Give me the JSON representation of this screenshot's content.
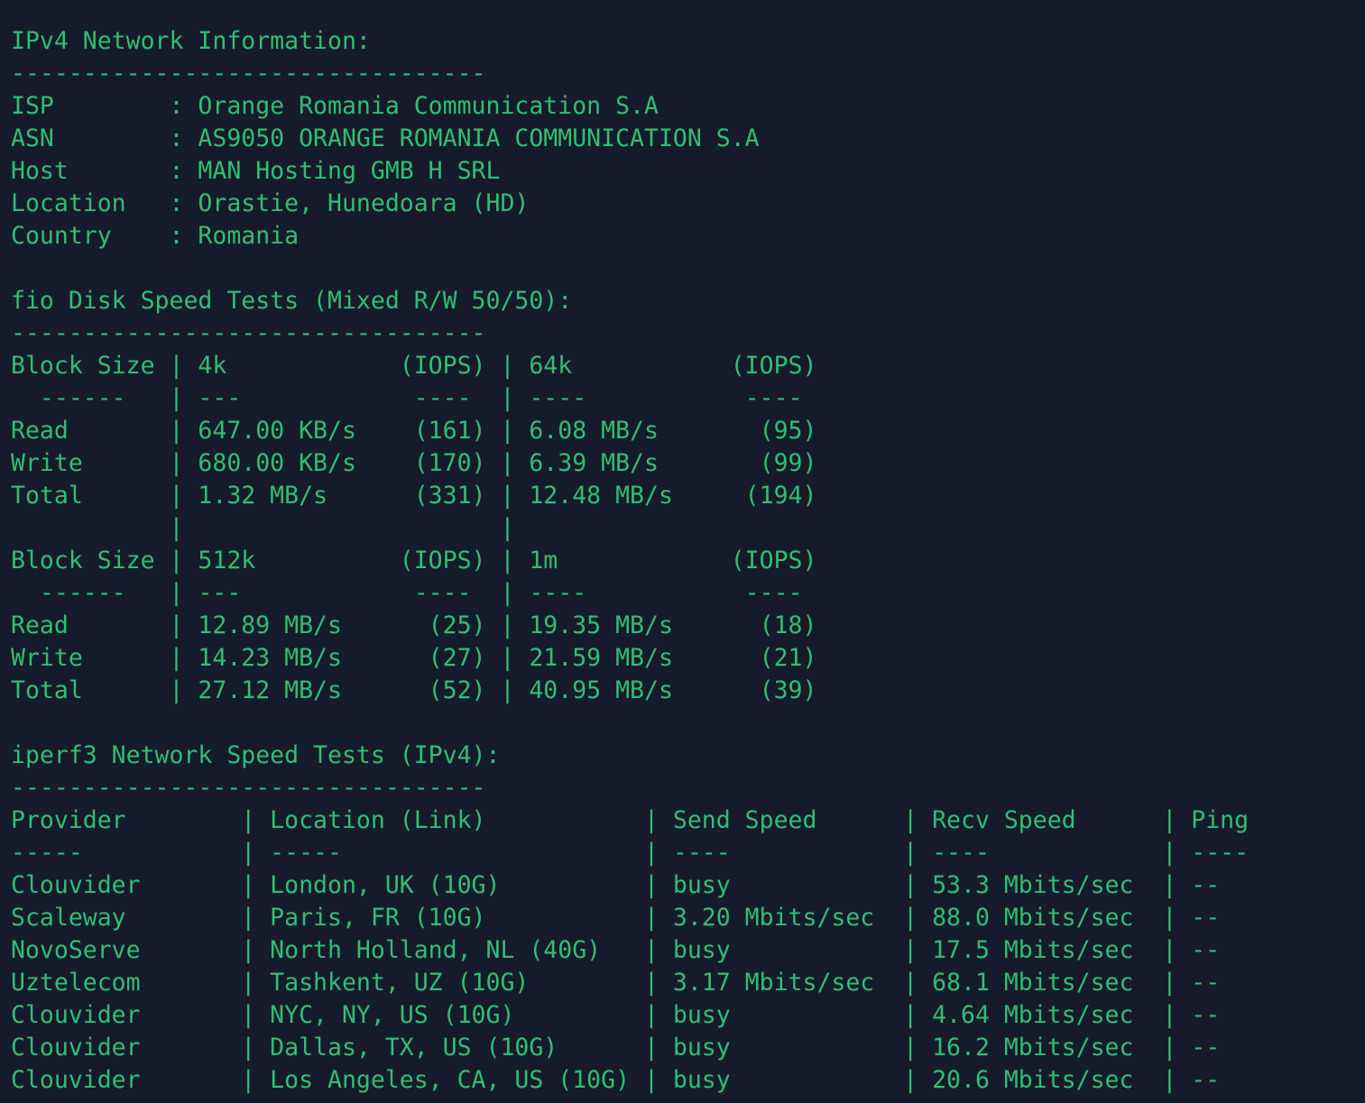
{
  "terminal": {
    "text_color": "#2fbf71",
    "background_color": "#161b2b",
    "lines": [
      "IPv4 Network Information:",
      "---------------------------------",
      "ISP        : Orange Romania Communication S.A",
      "ASN        : AS9050 ORANGE ROMANIA COMMUNICATION S.A",
      "Host       : MAN Hosting GMB H SRL",
      "Location   : Orastie, Hunedoara (HD)",
      "Country    : Romania",
      "",
      "fio Disk Speed Tests (Mixed R/W 50/50):",
      "---------------------------------",
      "Block Size | 4k            (IOPS) | 64k           (IOPS)",
      "  ------   | ---            ----  | ----           ----",
      "Read       | 647.00 KB/s    (161) | 6.08 MB/s       (95)",
      "Write      | 680.00 KB/s    (170) | 6.39 MB/s       (99)",
      "Total      | 1.32 MB/s      (331) | 12.48 MB/s     (194)",
      "           |                      |",
      "Block Size | 512k          (IOPS) | 1m            (IOPS)",
      "  ------   | ---            ----  | ----           ----",
      "Read       | 12.89 MB/s      (25) | 19.35 MB/s      (18)",
      "Write      | 14.23 MB/s      (27) | 21.59 MB/s      (21)",
      "Total      | 27.12 MB/s      (52) | 40.95 MB/s      (39)",
      "",
      "iperf3 Network Speed Tests (IPv4):",
      "---------------------------------",
      "Provider        | Location (Link)           | Send Speed      | Recv Speed      | Ping",
      "-----           | -----                     | ----            | ----            | ----",
      "Clouvider       | London, UK (10G)          | busy            | 53.3 Mbits/sec  | --",
      "Scaleway        | Paris, FR (10G)           | 3.20 Mbits/sec  | 88.0 Mbits/sec  | --",
      "NovoServe       | North Holland, NL (40G)   | busy            | 17.5 Mbits/sec  | --",
      "Uztelecom       | Tashkent, UZ (10G)        | 3.17 Mbits/sec  | 68.1 Mbits/sec  | --",
      "Clouvider       | NYC, NY, US (10G)         | busy            | 4.64 Mbits/sec  | --",
      "Clouvider       | Dallas, TX, US (10G)      | busy            | 16.2 Mbits/sec  | --",
      "Clouvider       | Los Angeles, CA, US (10G) | busy            | 20.6 Mbits/sec  | --"
    ]
  }
}
